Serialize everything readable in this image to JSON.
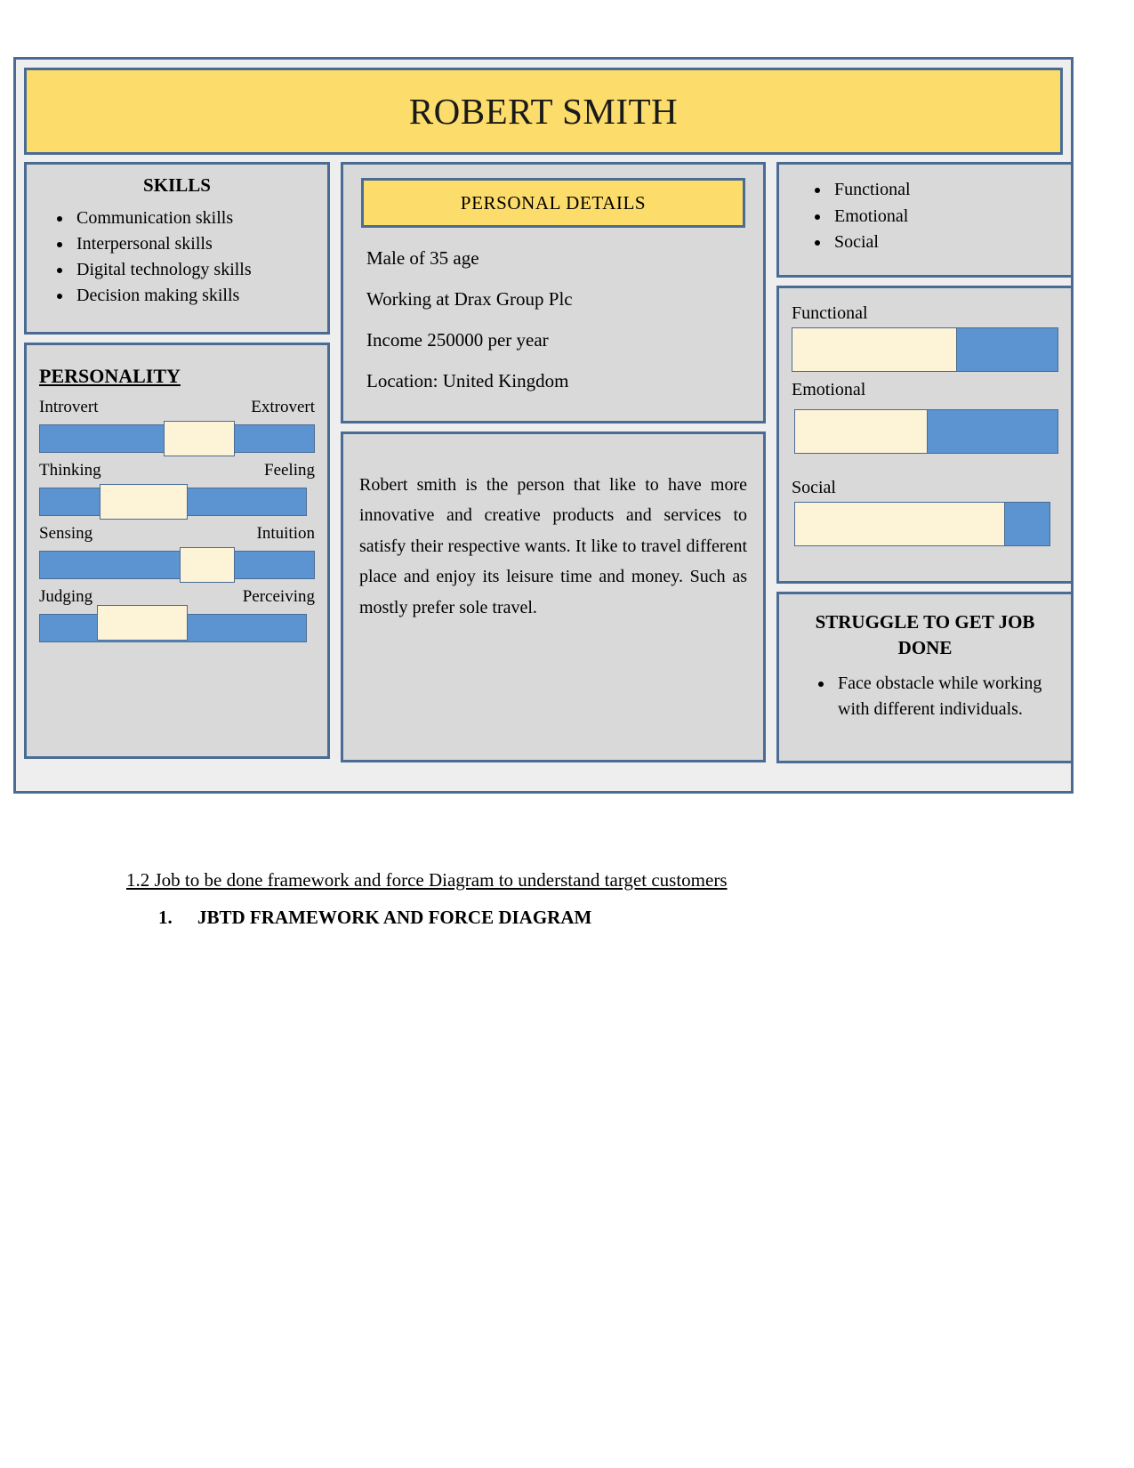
{
  "persona": {
    "name": "ROBERT SMITH",
    "skills": {
      "heading": "SKILLS",
      "items": [
        "Communication skills",
        "Interpersonal skills",
        "Digital technology skills",
        "Decision making skills"
      ]
    },
    "personality": {
      "heading": "PERSONALITY",
      "traits": [
        {
          "left_label": "Introvert",
          "right_label": "Extrovert",
          "knob_left_pct": 45,
          "knob_width_pct": 26
        },
        {
          "left_label": "Thinking",
          "right_label": "Feeling",
          "knob_left_pct": 22,
          "knob_width_pct": 32
        },
        {
          "left_label": "Sensing",
          "right_label": "Intuition",
          "knob_left_pct": 51,
          "knob_width_pct": 20
        },
        {
          "left_label": "Judging",
          "right_label": "Perceiving",
          "knob_left_pct": 21,
          "knob_width_pct": 33
        }
      ]
    },
    "personal_details": {
      "header": "PERSONAL DETAILS",
      "lines": [
        "Male of 35 age",
        "Working at Drax Group Plc",
        " Income 250000 per year",
        "Location: United Kingdom"
      ]
    },
    "bio": "Robert smith is the person that like to have more innovative and creative products and services to satisfy their respective wants. It like to travel different place and enjoy its leisure time and money. Such as mostly prefer sole travel.",
    "needs": {
      "items": [
        "Functional",
        "Emotional",
        "Social"
      ]
    },
    "meters": [
      {
        "label": "Functional",
        "fill_pct": 62
      },
      {
        "label": "Emotional",
        "fill_pct": 50
      },
      {
        "label": "Social",
        "fill_pct": 79
      }
    ],
    "struggle": {
      "heading": "STRUGGLE TO GET JOB DONE",
      "items": [
        "Face obstacle while working with different individuals."
      ]
    }
  },
  "document": {
    "section_heading": "1.2 Job to be done framework and force Diagram to understand target customers",
    "numbered_item": {
      "number": "1.",
      "text": "JBTD FRAMEWORK AND FORCE DIAGRAM"
    }
  },
  "colors": {
    "accent_yellow": "#fcdc6a",
    "border_blue": "#4a6c94",
    "bar_blue": "#5b94d0",
    "bar_cream": "#fdf3d7",
    "panel_gray": "#d9d9d9",
    "frame_gray": "#eeeeee"
  }
}
